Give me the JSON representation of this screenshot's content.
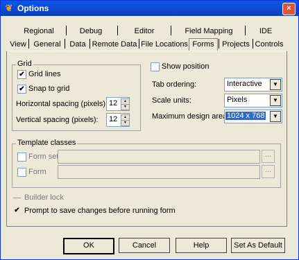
{
  "window": {
    "title": "Options",
    "close_glyph": "×",
    "icon": "app-logo-icon"
  },
  "tabs_row1": [
    "Regional",
    "Debug",
    "Editor",
    "Field Mapping",
    "IDE"
  ],
  "tabs_row2": [
    "View",
    "General",
    "Data",
    "Remote Data",
    "File Locations",
    "Forms",
    "Projects",
    "Controls"
  ],
  "active_tab": "Forms",
  "grid": {
    "legend": "Grid",
    "grid_lines": {
      "label": "Grid lines",
      "checked": true
    },
    "snap_to_grid": {
      "label": "Snap to grid",
      "checked": true
    },
    "horizontal_spacing": {
      "label": "Horizontal spacing (pixels):",
      "value": "12"
    },
    "vertical_spacing": {
      "label": "Vertical spacing (pixels):",
      "value": "12"
    }
  },
  "right": {
    "show_position": {
      "label": "Show position",
      "checked": false
    },
    "tab_ordering": {
      "label": "Tab ordering:",
      "value": "Interactive"
    },
    "scale_units": {
      "label": "Scale units:",
      "value": "Pixels"
    },
    "max_design_area": {
      "label": "Maximum design area:",
      "value": "1024 x 768"
    }
  },
  "template": {
    "legend": "Template classes",
    "form_set": {
      "label": "Form set",
      "checked": false
    },
    "form": {
      "label": "Form",
      "checked": false
    },
    "ellipsis": "..."
  },
  "builder_lock": {
    "label": "Builder lock",
    "checked": false
  },
  "prompt_save": {
    "label": "Prompt to save changes before running form",
    "checked": true
  },
  "buttons": {
    "ok": "OK",
    "cancel": "Cancel",
    "help": "Help",
    "set_default": "Set As Default"
  },
  "check_glyph": "✔"
}
